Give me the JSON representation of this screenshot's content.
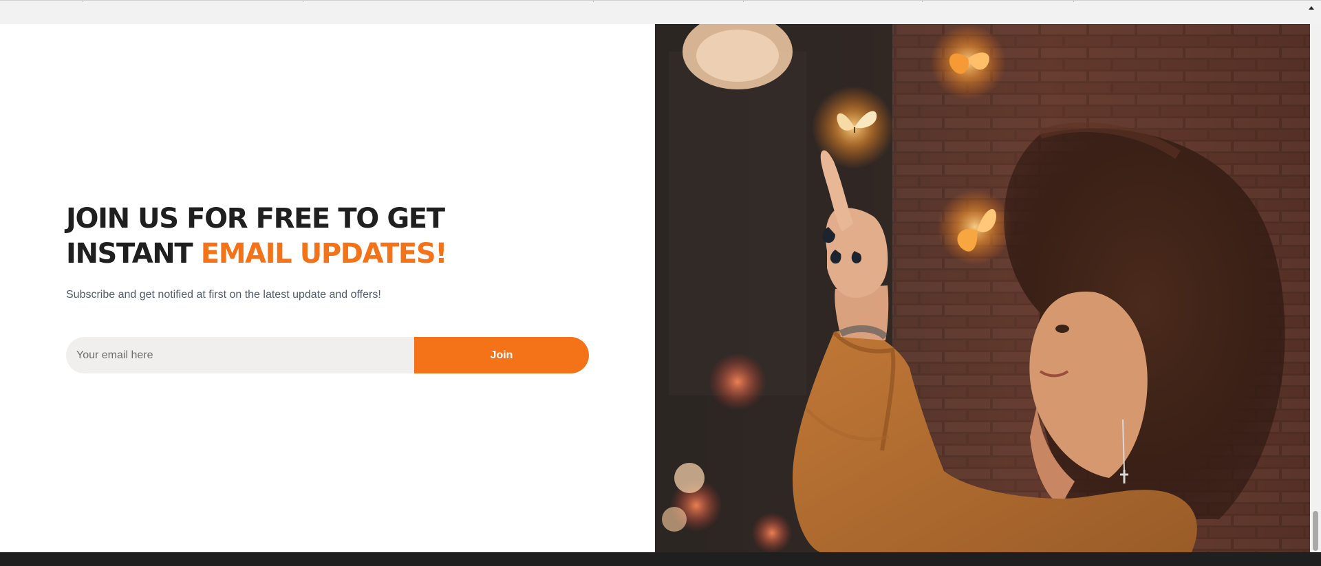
{
  "newsletter": {
    "headline_main": "JOIN US FOR FREE TO GET INSTANT ",
    "headline_accent": "EMAIL UPDATES!",
    "subtitle": "Subscribe and get notified at first on the latest update and offers!",
    "email_placeholder": "Your email here",
    "join_label": "Join"
  },
  "colors": {
    "accent": "#f47218",
    "headline": "#1f1f1f",
    "subtitle": "#4f5b6b",
    "input_background": "#f0efed",
    "footer": "#1f1f1f"
  },
  "icons": {
    "scroll_up": "up-arrow-icon"
  }
}
